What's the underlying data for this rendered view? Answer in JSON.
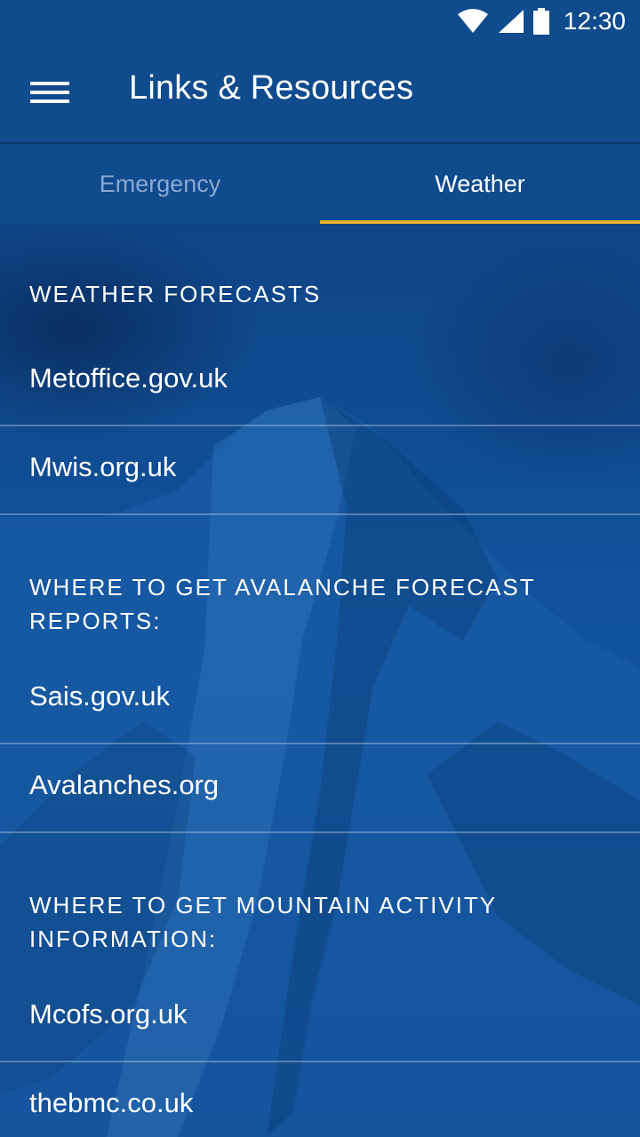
{
  "status_bar": {
    "time": "12:30",
    "icons": [
      "wifi-icon",
      "cell-signal-icon",
      "battery-icon"
    ]
  },
  "app_bar": {
    "menu_icon": "hamburger-menu-icon",
    "title": "Links & Resources"
  },
  "tabs": [
    {
      "label": "Emergency",
      "active": false
    },
    {
      "label": "Weather",
      "active": true
    }
  ],
  "colors": {
    "primary": "#0f4b8d",
    "tab_indicator": "#e7b22c",
    "inactive_tab_text": "#8aa9d3",
    "text": "#ffffff"
  },
  "sections": [
    {
      "header": "WEATHER FORECASTS",
      "links": [
        "Metoffice.gov.uk",
        "Mwis.org.uk"
      ]
    },
    {
      "header": "WHERE TO GET AVALANCHE FORECAST REPORTS:",
      "links": [
        "Sais.gov.uk",
        "Avalanches.org"
      ]
    },
    {
      "header": "WHERE TO GET MOUNTAIN ACTIVITY INFORMATION:",
      "links": [
        "Mcofs.org.uk",
        "thebmc.co.uk"
      ]
    }
  ]
}
